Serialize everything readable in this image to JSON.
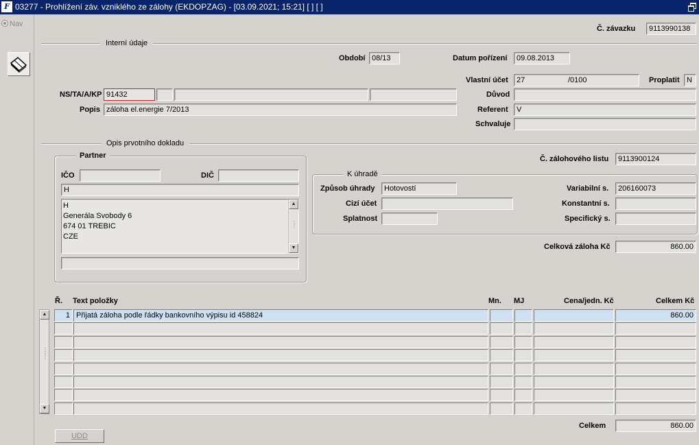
{
  "window": {
    "app_icon": "F",
    "title": "03277 - Prohlížení záv. vzniklého ze zálohy (EKDOPZAG) - [03.09.2021; 15:21] [ ] [ ]"
  },
  "nav": {
    "label": "Nav"
  },
  "header": {
    "c_zavazku_label": "Č. závazku",
    "c_zavazku_value": "9113990138",
    "interni_udaje": "Interní údaje",
    "obdobi_label": "Období",
    "obdobi_value": "08/13",
    "datum_porizeni_label": "Datum pořízení",
    "datum_porizeni_value": "09.08.2013",
    "vlastni_ucet_label": "Vlastní účet",
    "vlastni_ucet_value": "27",
    "vlastni_ucet_bank": "/0100",
    "proplatit_label": "Proplatit",
    "proplatit_value": "N",
    "ns_label": "NS/TA/A/KP",
    "ns_value": "91432",
    "duvod_label": "Důvod",
    "popis_label": "Popis",
    "popis_value": "záloha el.energie 7/2013",
    "referent_label": "Referent",
    "referent_value": "V",
    "schvaluje_label": "Schvaluje"
  },
  "doklad": {
    "section_title": "Opis prvotního dokladu",
    "partner_title": "Partner",
    "ico_label": "IČO",
    "dic_label": "DIČ",
    "partner_name": "H",
    "address_lines": [
      "H",
      "Generála Svobody 6",
      "674 01 TREBIC",
      "CZE"
    ],
    "c_zalohoveho_listu_label": "Č. zálohového listu",
    "c_zalohoveho_listu_value": "9113900124",
    "k_uhrade_title": "K úhradě",
    "zpusob_uhrady_label": "Způsob úhrady",
    "zpusob_uhrady_value": "Hotovostí",
    "cizi_ucet_label": "Cizí účet",
    "splatnost_label": "Splatnost",
    "variabilni_label": "Variabilní s.",
    "variabilni_value": "206160073",
    "konstantni_label": "Konstantní s.",
    "specificky_label": "Specifický s.",
    "celkova_zaloha_label": "Celková záloha Kč",
    "celkova_zaloha_value": "860.00"
  },
  "table": {
    "headers": {
      "r": "Ř.",
      "text": "Text položky",
      "mn": "Mn.",
      "mj": "MJ",
      "cena": "Cena/jedn. Kč",
      "celkem": "Celkem Kč"
    },
    "rows": [
      {
        "r": "1",
        "text": "Přijatá záloha podle řádky bankovního výpisu id 458824",
        "mn": "",
        "mj": "",
        "cena": "",
        "celkem": "860.00"
      },
      {
        "r": "",
        "text": "",
        "mn": "",
        "mj": "",
        "cena": "",
        "celkem": ""
      },
      {
        "r": "",
        "text": "",
        "mn": "",
        "mj": "",
        "cena": "",
        "celkem": ""
      },
      {
        "r": "",
        "text": "",
        "mn": "",
        "mj": "",
        "cena": "",
        "celkem": ""
      },
      {
        "r": "",
        "text": "",
        "mn": "",
        "mj": "",
        "cena": "",
        "celkem": ""
      },
      {
        "r": "",
        "text": "",
        "mn": "",
        "mj": "",
        "cena": "",
        "celkem": ""
      },
      {
        "r": "",
        "text": "",
        "mn": "",
        "mj": "",
        "cena": "",
        "celkem": ""
      },
      {
        "r": "",
        "text": "",
        "mn": "",
        "mj": "",
        "cena": "",
        "celkem": ""
      }
    ],
    "total_label": "Celkem",
    "total_value": "860.00"
  },
  "footer": {
    "udd_button": "UDD"
  },
  "colors": {
    "titlebar": "#0a246a",
    "background": "#d6d3ce",
    "selected_row": "#cfe0f3",
    "error_border": "#cc2222"
  }
}
